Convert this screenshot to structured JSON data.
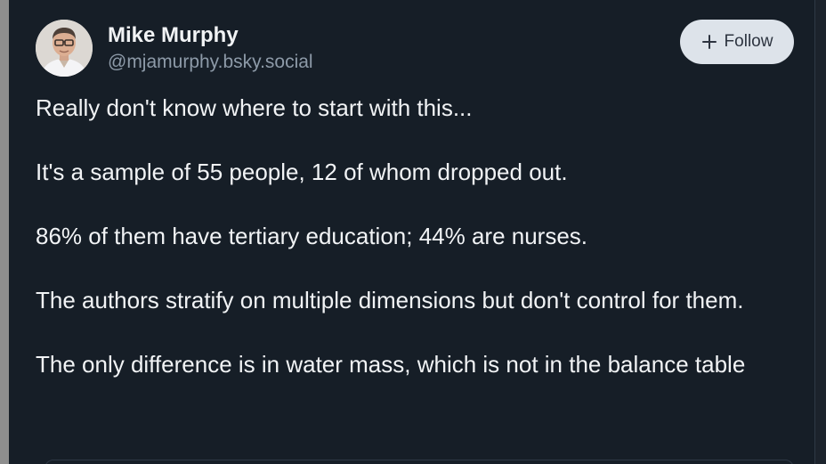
{
  "post": {
    "author": {
      "display_name": "Mike Murphy",
      "handle": "@mjamurphy.bsky.social"
    },
    "follow_label": "Follow",
    "paragraphs": [
      "Really don't know where to start with this...",
      "It's a sample of 55 people, 12 of whom dropped out.",
      "86% of them have tertiary education; 44% are nurses.",
      "The authors stratify on multiple dimensions but don't control for them.",
      "The only difference is in water mass, which is not in the balance table"
    ]
  },
  "colors": {
    "background": "#161e27",
    "text_primary": "#f1f3f5",
    "text_secondary": "#8d9aa8",
    "follow_button_bg": "#dde3ea",
    "follow_button_text": "#2d3440"
  },
  "icons": {
    "follow": "plus-icon",
    "avatar": "avatar-photo"
  }
}
